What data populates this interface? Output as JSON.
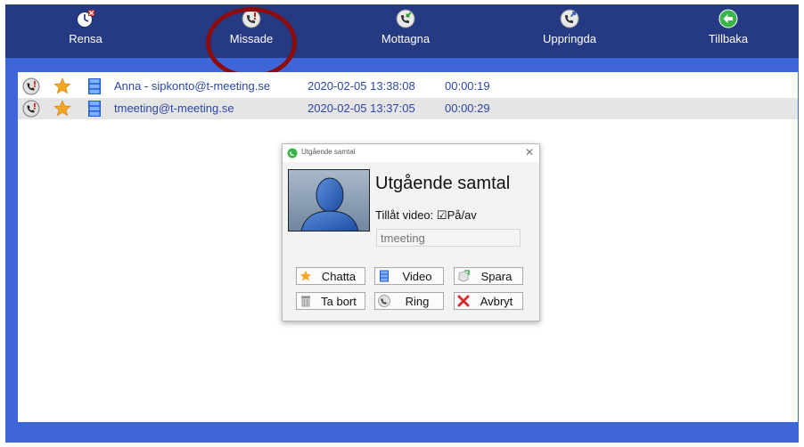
{
  "toolbar": {
    "buttons": [
      {
        "label": "Rensa",
        "icon": "clock-clear-icon"
      },
      {
        "label": "Missade",
        "icon": "missed-call-icon"
      },
      {
        "label": "Mottagna",
        "icon": "received-call-icon"
      },
      {
        "label": "Uppringda",
        "icon": "dialed-call-icon"
      },
      {
        "label": "Tillbaka",
        "icon": "back-arrow-icon"
      }
    ],
    "active": "Missade"
  },
  "calls": [
    {
      "contact": "Anna - sipkonto@t-meeting.se",
      "datetime": "2020-02-05 13:38:08",
      "duration": "00:00:19"
    },
    {
      "contact": "tmeeting@t-meeting.se",
      "datetime": "2020-02-05 13:37:05",
      "duration": "00:00:29"
    }
  ],
  "dialog": {
    "window_title": "Utgående samtal",
    "heading": "Utgående samtal",
    "video_label": "Tillåt video:",
    "video_option": "På/av",
    "video_checked": true,
    "name_value": "tmeeting",
    "buttons": {
      "chat": "Chatta",
      "video": "Video",
      "save": "Spara",
      "delete": "Ta bort",
      "call": "Ring",
      "cancel": "Avbryt"
    }
  },
  "colors": {
    "toolbar_bg": "#253a82",
    "frame_bg": "#3f66d8",
    "link_text": "#2b47a8",
    "highlight_ring": "#8b0d0f"
  }
}
